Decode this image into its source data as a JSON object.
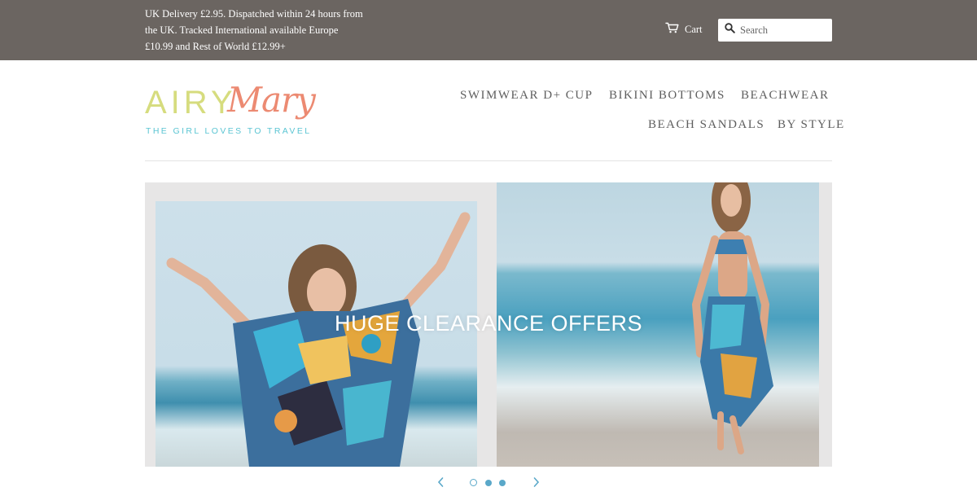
{
  "announcement": {
    "line1": "UK Delivery £2.95. Dispatched within 24 hours from",
    "line2": "the UK. Tracked International available Europe",
    "line3": "£10.99 and Rest of World £12.99+"
  },
  "header": {
    "cart_label": "Cart",
    "search_placeholder": "Search",
    "cart_icon": "cart-icon",
    "search_icon": "search-icon"
  },
  "logo": {
    "word1": "AIRY",
    "word2": "Mary",
    "tagline": "THE GIRL LOVES TO TRAVEL",
    "colors": {
      "word1": "#d6dc7e",
      "word2": "#ec8a72",
      "tagline": "#5bc5d3"
    }
  },
  "nav": {
    "items": [
      {
        "label": "SWIMWEAR D+ CUP"
      },
      {
        "label": "BIKINI BOTTOMS"
      },
      {
        "label": "BEACHWEAR"
      },
      {
        "label": "BEACH SANDALS"
      },
      {
        "label": "BY STYLE"
      }
    ]
  },
  "hero": {
    "title": "HUGE CLEARANCE OFFERS",
    "slide_count": 3,
    "active_slide": 1,
    "prev_icon": "chevron-left-icon",
    "next_icon": "chevron-right-icon"
  },
  "colors": {
    "topbar": "#6b6561",
    "accent": "#5aa8c9",
    "nav_text": "#5e5e5e"
  }
}
